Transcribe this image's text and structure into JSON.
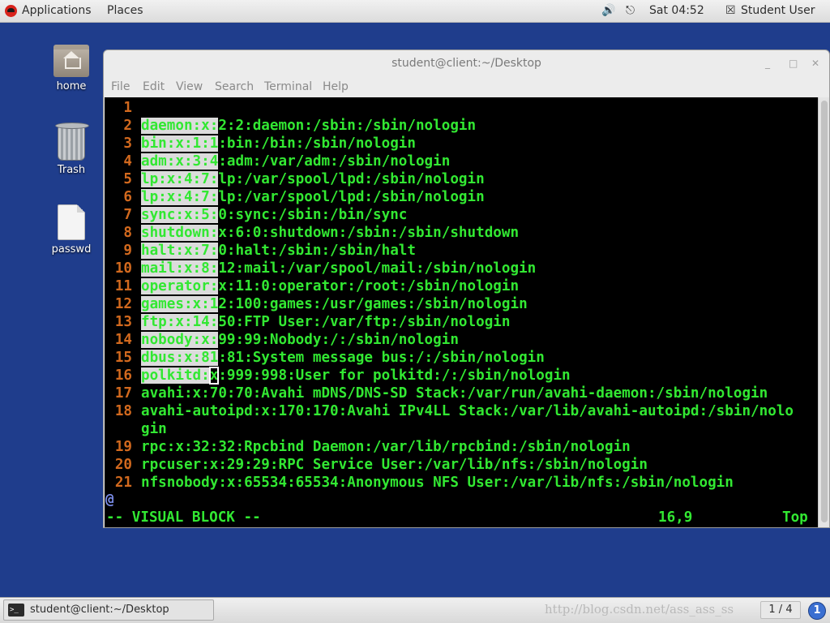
{
  "top_panel": {
    "applications": "Applications",
    "places": "Places",
    "clock": "Sat 04:52",
    "user": "Student User",
    "icons": {
      "logo": "redhat-logo-icon",
      "volume": "volume-icon",
      "network": "network-icon",
      "user": "user-menu-icon"
    }
  },
  "desktop": {
    "icons": [
      {
        "label": "home",
        "icon": "home-folder-icon"
      },
      {
        "label": "Trash",
        "icon": "trash-icon"
      },
      {
        "label": "passwd",
        "icon": "document-icon"
      }
    ]
  },
  "window": {
    "title": "student@client:~/Desktop",
    "menu": [
      "File",
      "Edit",
      "View",
      "Search",
      "Terminal",
      "Help"
    ]
  },
  "editor": {
    "lines": [
      {
        "num": "1",
        "pre": "",
        "cur": "",
        "post": ""
      },
      {
        "num": "2",
        "pre": "daemon:x:",
        "cur": "",
        "post": "2:2:daemon:/sbin:/sbin/nologin"
      },
      {
        "num": "3",
        "pre": "bin:x:1:1",
        "cur": "",
        "post": ":bin:/bin:/sbin/nologin"
      },
      {
        "num": "4",
        "pre": "adm:x:3:4",
        "cur": "",
        "post": ":adm:/var/adm:/sbin/nologin"
      },
      {
        "num": "5",
        "pre": "lp:x:4:7:",
        "cur": "",
        "post": "lp:/var/spool/lpd:/sbin/nologin"
      },
      {
        "num": "6",
        "pre": "lp:x:4:7:",
        "cur": "",
        "post": "lp:/var/spool/lpd:/sbin/nologin"
      },
      {
        "num": "7",
        "pre": "sync:x:5:",
        "cur": "",
        "post": "0:sync:/sbin:/bin/sync"
      },
      {
        "num": "8",
        "pre": "shutdown:",
        "cur": "",
        "post": "x:6:0:shutdown:/sbin:/sbin/shutdown"
      },
      {
        "num": "9",
        "pre": "halt:x:7:",
        "cur": "",
        "post": "0:halt:/sbin:/sbin/halt"
      },
      {
        "num": "10",
        "pre": "mail:x:8:",
        "cur": "",
        "post": "12:mail:/var/spool/mail:/sbin/nologin"
      },
      {
        "num": "11",
        "pre": "operator:",
        "cur": "",
        "post": "x:11:0:operator:/root:/sbin/nologin"
      },
      {
        "num": "12",
        "pre": "games:x:1",
        "cur": "",
        "post": "2:100:games:/usr/games:/sbin/nologin"
      },
      {
        "num": "13",
        "pre": "ftp:x:14:",
        "cur": "",
        "post": "50:FTP User:/var/ftp:/sbin/nologin"
      },
      {
        "num": "14",
        "pre": "nobody:x:",
        "cur": "",
        "post": "99:99:Nobody:/:/sbin/nologin"
      },
      {
        "num": "15",
        "pre": "dbus:x:81",
        "cur": "",
        "post": ":81:System message bus:/:/sbin/nologin"
      },
      {
        "num": "16",
        "pre": "polkitd:",
        "cur": "x",
        "post": ":999:998:User for polkitd:/:/sbin/nologin"
      },
      {
        "num": "17",
        "pre": "",
        "cur": "",
        "post": "avahi:x:70:70:Avahi mDNS/DNS-SD Stack:/var/run/avahi-daemon:/sbin/nologin"
      },
      {
        "num": "18",
        "pre": "",
        "cur": "",
        "post": "avahi-autoipd:x:170:170:Avahi IPv4LL Stack:/var/lib/avahi-autoipd:/sbin/nolo"
      },
      {
        "num": "",
        "pre": "",
        "cur": "",
        "post": "gin"
      },
      {
        "num": "19",
        "pre": "",
        "cur": "",
        "post": "rpc:x:32:32:Rpcbind Daemon:/var/lib/rpcbind:/sbin/nologin"
      },
      {
        "num": "20",
        "pre": "",
        "cur": "",
        "post": "rpcuser:x:29:29:RPC Service User:/var/lib/nfs:/sbin/nologin"
      },
      {
        "num": "21",
        "pre": "",
        "cur": "",
        "post": "nfsnobody:x:65534:65534:Anonymous NFS User:/var/lib/nfs:/sbin/nologin"
      }
    ],
    "overflow_marker": "@",
    "mode": "-- VISUAL BLOCK --",
    "position": "16,9",
    "scroll": "Top"
  },
  "taskbar": {
    "task_label": "student@client:~/Desktop",
    "task_icon": "terminal-icon",
    "watermark": "http://blog.csdn.net/ass_ass_ss",
    "pager": "1 / 4",
    "notification_icon": "notification-icon",
    "notification_symbol": "1"
  },
  "colors": {
    "desktop_bg": "#1f3d8c",
    "terminal_bg": "#000000",
    "text_green": "#32e832",
    "line_number": "#d2691e",
    "selection": "#dcdcdc"
  }
}
